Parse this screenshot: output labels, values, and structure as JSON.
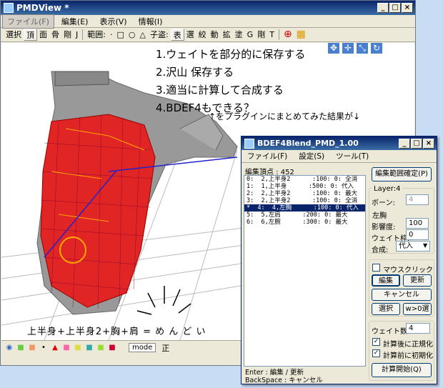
{
  "main": {
    "title": "PMDView *",
    "controls": [
      "_",
      "□",
      "×"
    ],
    "menus": [
      "ファイル(F)",
      "編集(E)",
      "表示(V)",
      "情報(I)"
    ],
    "toolbar": [
      "選択",
      "頂",
      "面",
      "骨",
      "剛",
      "J",
      "範囲:",
      "·",
      "□",
      "○",
      "△",
      "子盗:",
      "表",
      "選",
      "絞",
      "動",
      "拡",
      "塗",
      "G",
      "剛",
      "T"
    ],
    "steps": [
      "1.ウェイトを部分的に保存する",
      "2.沢山 保存する",
      "3.適当に計算して合成する",
      "4.BDEF4もできる？"
    ],
    "note": "↑をプラグインにまとめてみた結果が↓",
    "formula": "上半身+上半身2+胸+肩 = め ん ど い",
    "status_mode": "mode",
    "status_right": "正"
  },
  "dialog": {
    "title": "BDEF4Blend_PMD_1.00",
    "controls": [
      "_",
      "□",
      "×"
    ],
    "menus": [
      "ファイル(F)",
      "設定(S)",
      "ツール(T)"
    ],
    "edit_count_label": "編集頂点 : 452",
    "range_button": "編集範囲確定(P)",
    "rows": [
      "0:  2,上半身2      :100: 0: 全消",
      "1:  1,上半身      :500: 0: 代入",
      "2:  2,上半身2      :100: 0: 最大",
      "3:  2,上半身2      :100: 0: 全消",
      "*  4:  4,左胸      :100: 0: 代入",
      "5:  5,左肩      :200: 0: 最大",
      "6:  6,左腕      :300: 0: 最大"
    ],
    "layer_title": "Layer:4",
    "bone_label": "ボーン:",
    "bone_value": "4",
    "bone_name": "左胸",
    "influence_label": "影響度:",
    "influence_value": "100",
    "frame_label": "ウェイト枠:",
    "frame_value": "0",
    "combine_label": "合成:",
    "combine_value": "代入",
    "mouse_click_label": "マウスクリック(R)",
    "edit_button": "編集",
    "update_button": "更新",
    "cancel_button": "キャンセル",
    "select_button": "選択",
    "w0_button": "w>0選",
    "weight_count_label": "ウェイト数:",
    "weight_count_value": "4",
    "normalize_after": "計算後に正規化",
    "normalize_before": "計算前に初期化",
    "start_button": "計算開始(Q)",
    "help1": "Enter : 編集 / 更新",
    "help2": "BackSpace : キャンセル"
  }
}
